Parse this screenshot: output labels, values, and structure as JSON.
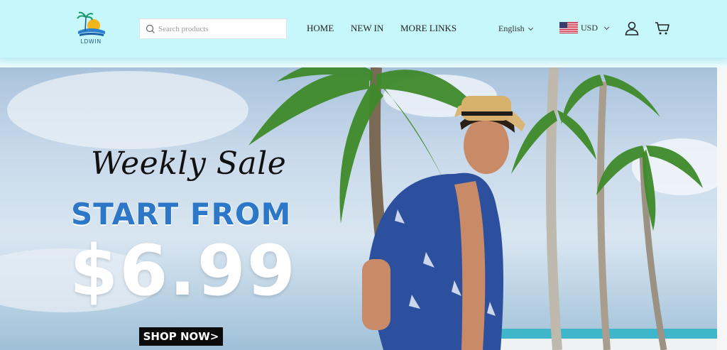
{
  "brand": {
    "logo_text": "LDWIN"
  },
  "search": {
    "placeholder": "Search products"
  },
  "nav": {
    "home": "HOME",
    "new_in": "NEW IN",
    "more_links": "MORE LINKS"
  },
  "locale": {
    "language": "English",
    "currency": "USD"
  },
  "hero": {
    "script_title": "Weekly Sale",
    "headline": "START FROM",
    "price": "$6.99",
    "cta": "SHOP NOW>"
  },
  "colors": {
    "header_bg": "#c6f7fb",
    "headline_blue": "#2d77c9",
    "cta_bg": "#0b0b0b"
  },
  "icons": {
    "search": "search-icon",
    "account": "user-icon",
    "cart": "cart-icon",
    "flag": "us-flag-icon"
  }
}
